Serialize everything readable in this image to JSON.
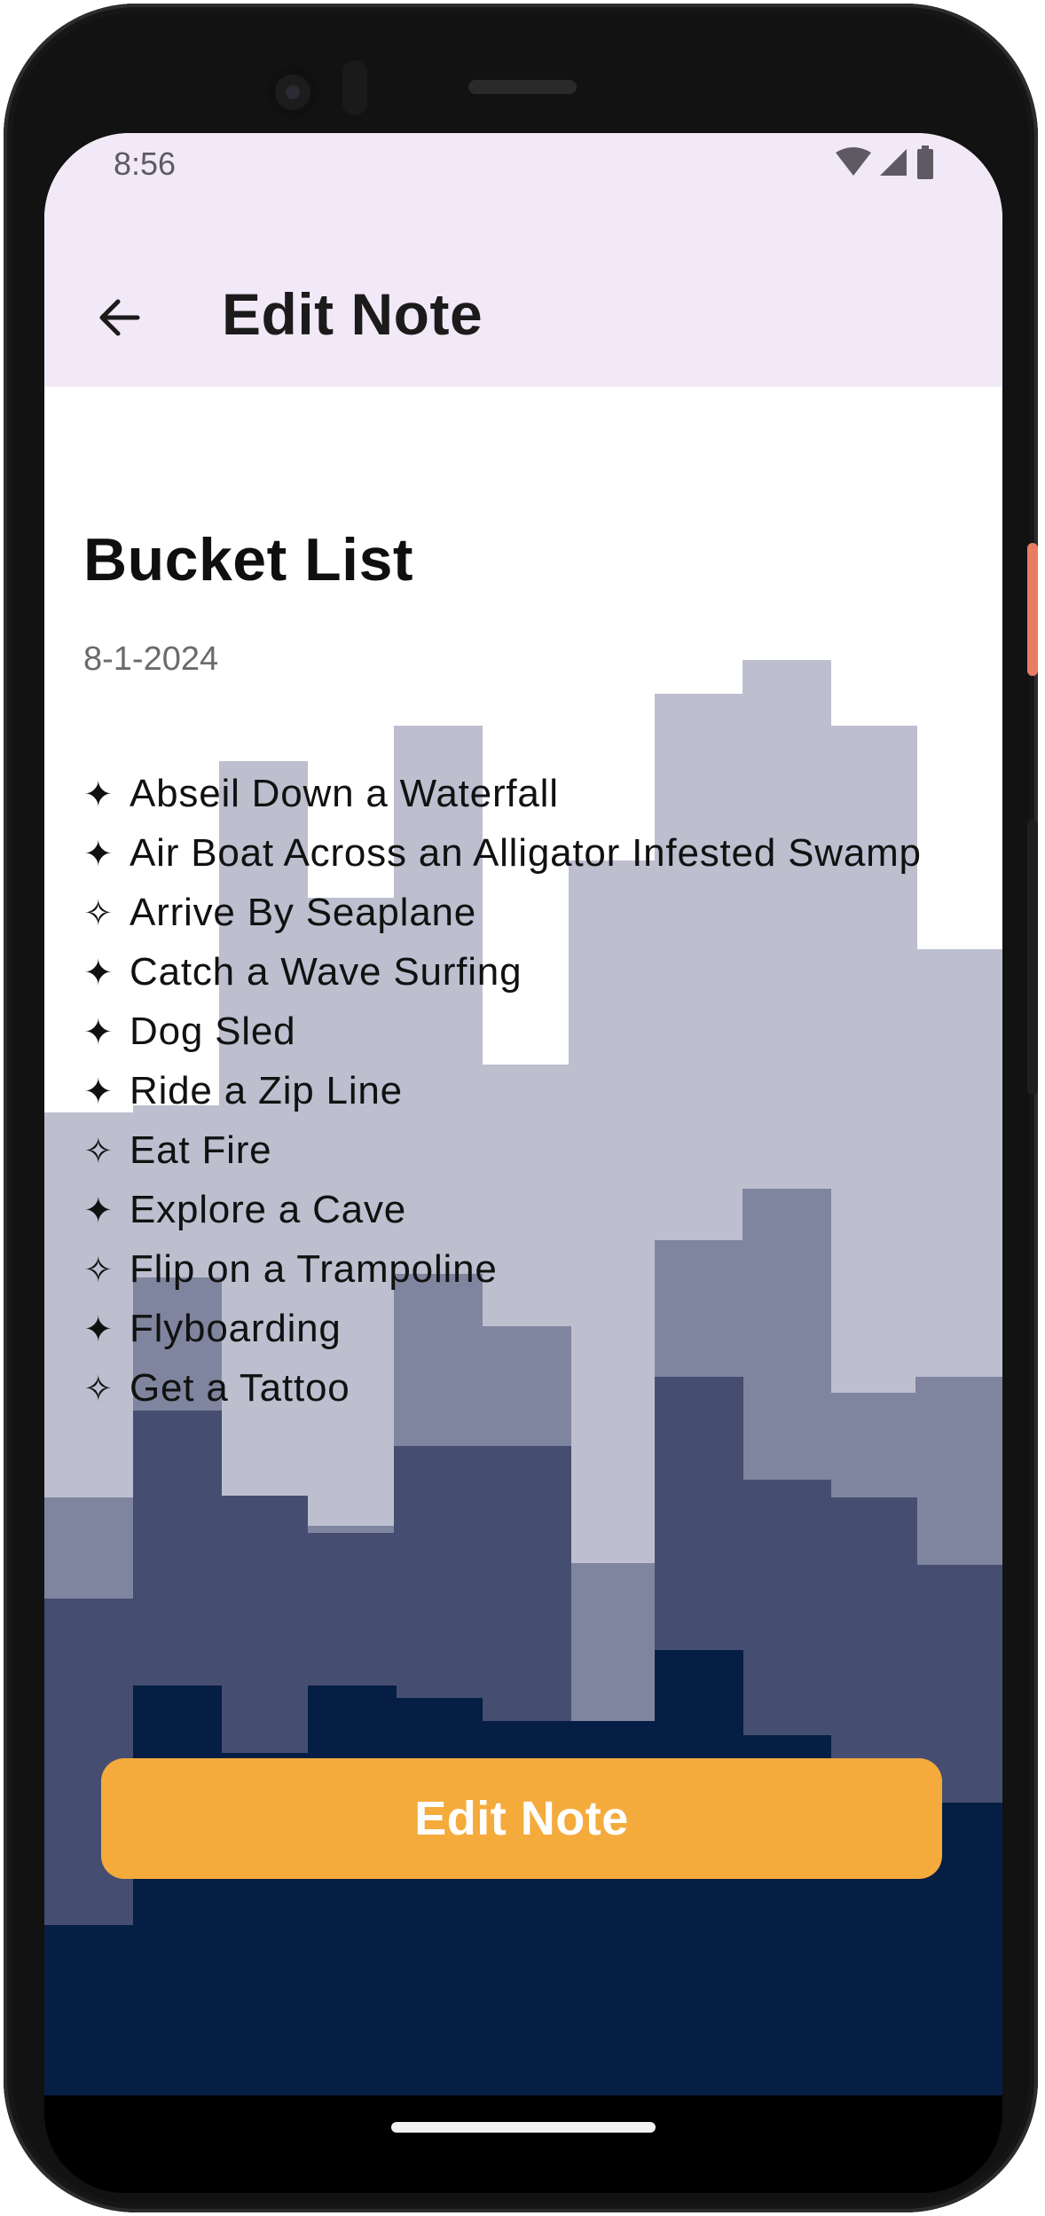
{
  "status_bar": {
    "time": "8:56"
  },
  "app_bar": {
    "title": "Edit Note",
    "back_icon": "arrow-back-icon"
  },
  "note": {
    "title": "Bucket List",
    "date": "8-1-2024",
    "items": [
      {
        "mark": "✦",
        "text": "Abseil Down a Waterfall"
      },
      {
        "mark": "✦",
        "text": "Air Boat Across an Alligator Infested Swamp"
      },
      {
        "mark": "✧",
        "text": "Arrive By Seaplane"
      },
      {
        "mark": "✦",
        "text": "Catch a Wave Surfing"
      },
      {
        "mark": "✦",
        "text": "Dog Sled"
      },
      {
        "mark": "✦",
        "text": "Ride a Zip Line"
      },
      {
        "mark": "✧",
        "text": "Eat Fire"
      },
      {
        "mark": "✦",
        "text": "Explore a Cave"
      },
      {
        "mark": "✧",
        "text": "Flip on a Trampoline"
      },
      {
        "mark": "✦",
        "text": "Flyboarding"
      },
      {
        "mark": "✧",
        "text": "Get a Tattoo"
      }
    ]
  },
  "actions": {
    "edit_note_label": "Edit Note"
  },
  "colors": {
    "app_bar": "#f1e9f7",
    "button": "#f5ab3c",
    "skyline_light": "#bdbfcf",
    "skyline_mid": "#80859f",
    "skyline_dark": "#454e70",
    "skyline_deep": "#061e44"
  }
}
